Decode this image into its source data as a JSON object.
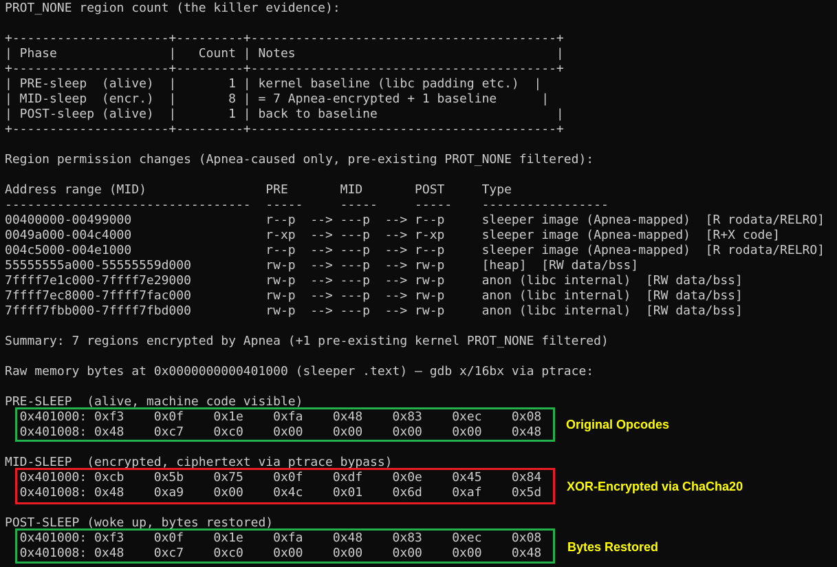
{
  "terminal": {
    "lines": [
      "PROT_NONE region count (the killer evidence):",
      "",
      "+---------------------+---------+-----------------------------------------+",
      "| Phase               |   Count | Notes                                   |",
      "+---------------------+---------+-----------------------------------------+",
      "| PRE-sleep  (alive)  |       1 | kernel baseline (libc padding etc.)  |",
      "| MID-sleep  (encr.)  |       8 | = 7 Apnea-encrypted + 1 baseline      |",
      "| POST-sleep (alive)  |       1 | back to baseline                        |",
      "+---------------------+---------+-----------------------------------------+",
      "",
      "Region permission changes (Apnea-caused only, pre-existing PROT_NONE filtered):",
      "",
      "Address range (MID)                PRE       MID       POST     Type",
      "---------------------------------  -----     -----     -----    -----------------",
      "00400000-00499000                  r--p  --> ---p  --> r--p     sleeper image (Apnea-mapped)  [R rodata/RELRO]",
      "0049a000-004c4000                  r-xp  --> ---p  --> r-xp     sleeper image (Apnea-mapped)  [R+X code]",
      "004c5000-004e1000                  r--p  --> ---p  --> r--p     sleeper image (Apnea-mapped)  [R rodata/RELRO]",
      "55555555a000-55555559d000          rw-p  --> ---p  --> rw-p     [heap]  [RW data/bss]",
      "7ffff7e1c000-7ffff7e29000          rw-p  --> ---p  --> rw-p     anon (libc internal)  [RW data/bss]",
      "7ffff7ec8000-7ffff7fac000          rw-p  --> ---p  --> rw-p     anon (libc internal)  [RW data/bss]",
      "7ffff7fbb000-7ffff7fbd000          rw-p  --> ---p  --> rw-p     anon (libc internal)  [RW data/bss]",
      "",
      "Summary: 7 regions encrypted by Apnea (+1 pre-existing kernel PROT_NONE filtered)",
      "",
      "Raw memory bytes at 0x0000000000401000 (sleeper .text) — gdb x/16bx via ptrace:",
      "",
      "PRE-SLEEP  (alive, machine code visible)",
      "  0x401000: 0xf3    0x0f    0x1e    0xfa    0x48    0x83    0xec    0x08",
      "  0x401008: 0x48    0xc7    0xc0    0x00    0x00    0x00    0x00    0x48",
      "",
      "MID-SLEEP  (encrypted, ciphertext via ptrace bypass)",
      "  0x401000: 0xcb    0x5b    0x75    0x0f    0xdf    0x0e    0x45    0x84",
      "  0x401008: 0x48    0xa9    0x00    0x4c    0x01    0x6d    0xaf    0x5d",
      "",
      "POST-SLEEP (woke up, bytes restored)",
      "  0x401000: 0xf3    0x0f    0x1e    0xfa    0x48    0x83    0xec    0x08",
      "  0x401008: 0x48    0xc7    0xc0    0x00    0x00    0x00    0x00    0x48"
    ]
  },
  "annotations": {
    "original": "Original Opcodes",
    "encrypted": "XOR-Encrypted via ChaCha20",
    "restored": "Bytes Restored"
  },
  "colors": {
    "background": "#0c0c0c",
    "text": "#cccccc",
    "annotation": "#ffff00",
    "box_green": "#22b14c",
    "box_red": "#ed1c24"
  }
}
